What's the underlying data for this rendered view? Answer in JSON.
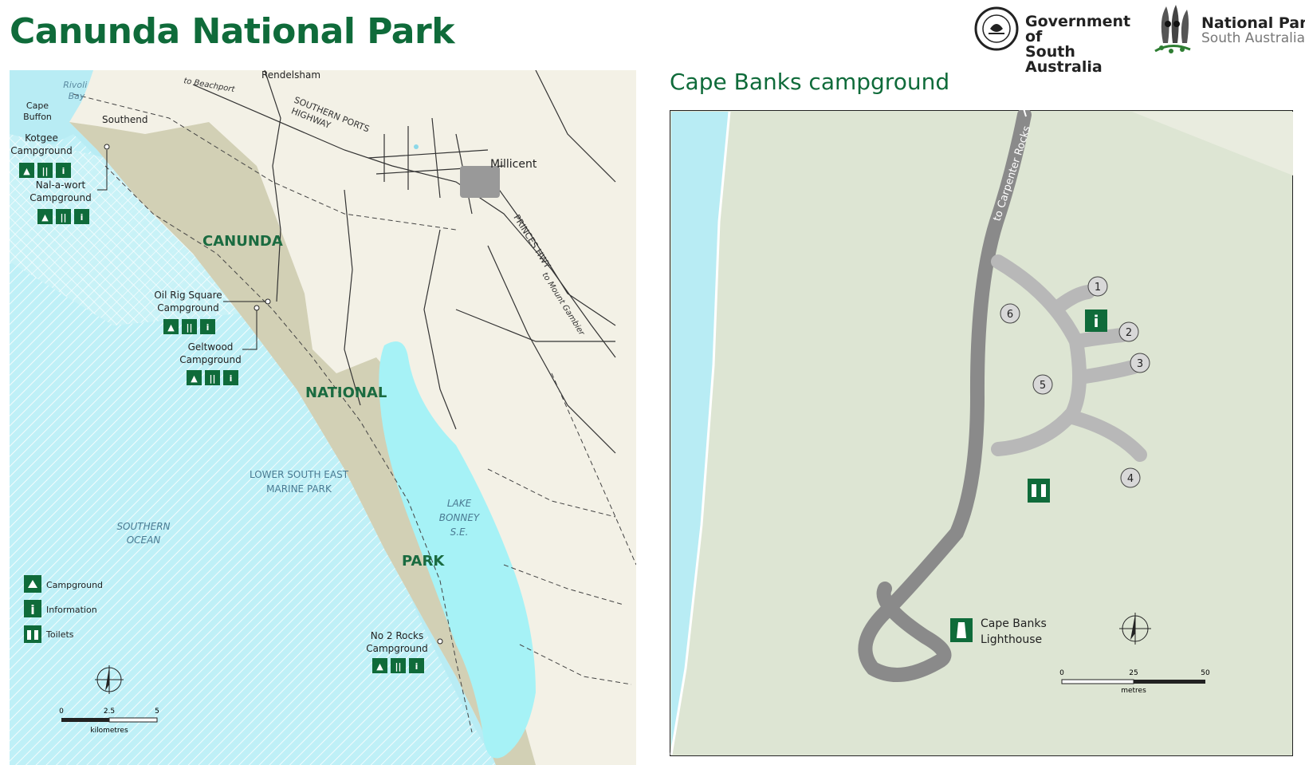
{
  "title": "Canunda National Park",
  "logos": {
    "government": [
      "Government of",
      "South Australia"
    ],
    "parks": [
      "National Parks",
      "South Australia"
    ]
  },
  "overview_map": {
    "towns": [
      "Rendelsham",
      "Southend",
      "Millicent"
    ],
    "water_labels": [
      "Rivoli Bay",
      "SOUTHERN OCEAN",
      "LAKE BONNEY S.E."
    ],
    "marine_park": "LOWER SOUTH EAST MARINE PARK",
    "park_name_parts": [
      "CANUNDA",
      "NATIONAL",
      "PARK"
    ],
    "roads": [
      "SOUTHERN PORTS HIGHWAY",
      "PRINCES HWY",
      "to Beachport",
      "to Mount Gambier"
    ],
    "cape": "Cape Buffon",
    "campgrounds": [
      {
        "name": "Kotgee Campground",
        "facilities": [
          "campground",
          "toilets",
          "information"
        ]
      },
      {
        "name": "Nal-a-wort Campground",
        "facilities": [
          "campground",
          "toilets",
          "information"
        ]
      },
      {
        "name": "Oil Rig Square Campground",
        "facilities": [
          "campground",
          "toilets",
          "information"
        ]
      },
      {
        "name": "Geltwood Campground",
        "facilities": [
          "campground",
          "toilets",
          "information"
        ]
      },
      {
        "name": "No 2 Rocks Campground",
        "facilities": [
          "campground",
          "toilets",
          "information"
        ]
      }
    ],
    "legend": [
      {
        "icon": "campground-icon",
        "label": "Campground"
      },
      {
        "icon": "information-icon",
        "label": "Information"
      },
      {
        "icon": "toilets-icon",
        "label": "Toilets"
      }
    ],
    "scale": {
      "ticks": [
        "0",
        "2.5",
        "5"
      ],
      "unit": "kilometres"
    }
  },
  "detail_map": {
    "title": "Cape Banks campground",
    "road_label": "to Carpenter Rocks",
    "sites": [
      "1",
      "2",
      "3",
      "4",
      "5",
      "6"
    ],
    "lighthouse": [
      "Cape Banks",
      "Lighthouse"
    ],
    "scale": {
      "ticks": [
        "0",
        "25",
        "50"
      ],
      "unit": "metres"
    }
  },
  "colors": {
    "brand_green": "#0f6b3a",
    "ocean": "#b8ecf4",
    "lake": "#a6f2f6",
    "land": "#f3f1e6",
    "park": "#d2d0b5",
    "detail_bg": "#dde5d3",
    "detail_road": "#8a8a8a",
    "detail_track": "#b8b8b8"
  }
}
